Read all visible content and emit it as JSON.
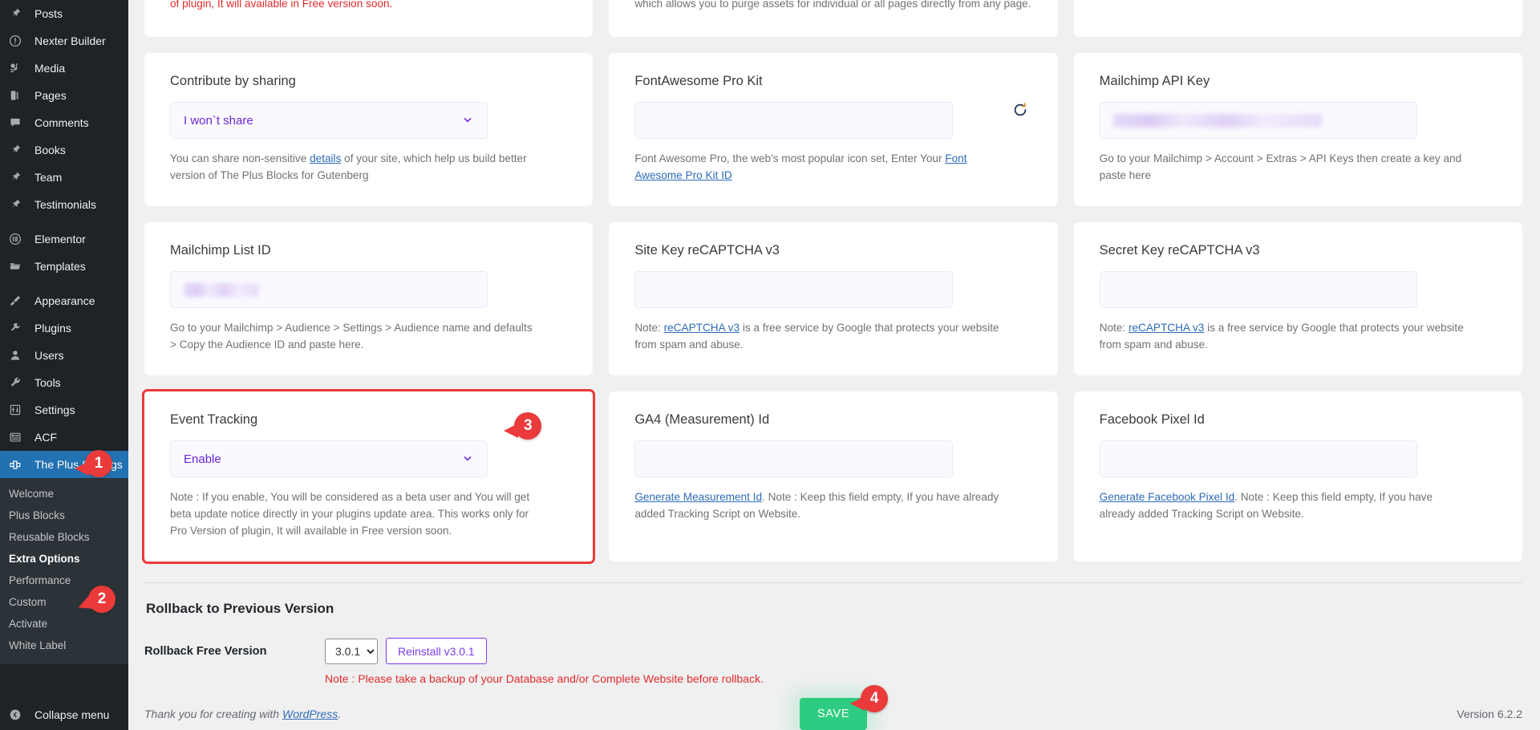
{
  "sidebar": {
    "items": [
      {
        "label": "Posts",
        "icon": "pin-icon"
      },
      {
        "label": "Nexter Builder",
        "icon": "nexter-icon"
      },
      {
        "label": "Media",
        "icon": "media-icon"
      },
      {
        "label": "Pages",
        "icon": "pages-icon"
      },
      {
        "label": "Comments",
        "icon": "comments-icon"
      },
      {
        "label": "Books",
        "icon": "pin-icon"
      },
      {
        "label": "Team",
        "icon": "pin-icon"
      },
      {
        "label": "Testimonials",
        "icon": "pin-icon"
      },
      {
        "label": "Elementor",
        "icon": "elementor-icon"
      },
      {
        "label": "Templates",
        "icon": "folder-icon"
      },
      {
        "label": "Appearance",
        "icon": "brush-icon"
      },
      {
        "label": "Plugins",
        "icon": "plug-icon"
      },
      {
        "label": "Users",
        "icon": "user-icon"
      },
      {
        "label": "Tools",
        "icon": "wrench-icon"
      },
      {
        "label": "Settings",
        "icon": "sliders-icon"
      },
      {
        "label": "ACF",
        "icon": "acf-icon"
      }
    ],
    "active_item": {
      "label": "The Plus Settings",
      "icon": "plus-settings-icon"
    },
    "submenu": [
      {
        "label": "Welcome"
      },
      {
        "label": "Plus Blocks"
      },
      {
        "label": "Reusable Blocks"
      },
      {
        "label": "Extra Options"
      },
      {
        "label": "Performance"
      },
      {
        "label": "Custom"
      },
      {
        "label": "Activate"
      },
      {
        "label": "White Label"
      }
    ],
    "current_submenu": "Extra Options",
    "collapse": {
      "label": "Collapse menu",
      "icon": "collapse-arrow-icon"
    }
  },
  "callouts": {
    "one": "1",
    "two": "2",
    "three": "3",
    "four": "4"
  },
  "cards": {
    "top_left_partial": {
      "help": "of plugin, It will available in Free version soon."
    },
    "top_mid_partial": {
      "help": "which allows you to purge assets for individual or all pages directly from any page."
    },
    "contribute": {
      "title": "Contribute by sharing",
      "value": "I won`t share",
      "help_pre": "You can share non-sensitive ",
      "help_link": "details",
      "help_post": " of your site, which help us build better version of The Plus Blocks for Gutenberg"
    },
    "fontawesome": {
      "title": "FontAwesome Pro Kit",
      "value": "",
      "help_pre": "Font Awesome Pro, the web's most popular icon set, Enter Your ",
      "help_link": "Font Awesome Pro Kit ID",
      "refresh_icon": "refresh-icon"
    },
    "mailchimp_api": {
      "title": "Mailchimp API Key",
      "value_redacted": true,
      "help": "Go to your Mailchimp > Account > Extras > API Keys then create a key and paste here"
    },
    "mailchimp_list": {
      "title": "Mailchimp List ID",
      "value_redacted": true,
      "help": "Go to your Mailchimp > Audience > Settings > Audience name and defaults > Copy the Audience ID and paste here."
    },
    "sitekey": {
      "title": "Site Key reCAPTCHA v3",
      "value": "",
      "help_pre": "Note: ",
      "help_link": "reCAPTCHA v3",
      "help_post": " is a free service by Google that protects your website from spam and abuse."
    },
    "secretkey": {
      "title": "Secret Key reCAPTCHA v3",
      "value": "",
      "help_pre": "Note: ",
      "help_link": "reCAPTCHA v3",
      "help_post": " is a free service by Google that protects your website from spam and abuse."
    },
    "event_tracking": {
      "title": "Event Tracking",
      "value": "Enable",
      "help": "Note : If you enable, You will be considered as a beta user and You will get beta update notice directly in your plugins update area. This works only for Pro Version of plugin, It will available in Free version soon."
    },
    "ga4": {
      "title": "GA4 (Measurement) Id",
      "value": "",
      "help_link": "Generate Measurement Id",
      "help_post": ". Note : Keep this field empty, If you have already added Tracking Script on Website."
    },
    "facebook_pixel": {
      "title": "Facebook Pixel Id",
      "value": "",
      "help_link": "Generate Facebook Pixel Id",
      "help_post": ". Note : Keep this field empty, If you have already added Tracking Script on Website."
    }
  },
  "rollback": {
    "heading": "Rollback to Previous Version",
    "label": "Rollback Free Version",
    "selected_version": "3.0.1",
    "version_options": [
      "3.0.1"
    ],
    "reinstall_label": "Reinstall v3.0.1",
    "note": "Note : Please take a backup of your Database and/or Complete Website before rollback."
  },
  "save": {
    "label": "SAVE"
  },
  "footer": {
    "thanks_pre": "Thank you for creating with ",
    "thanks_link": "WordPress",
    "thanks_post": ".",
    "version": "Version 6.2.2"
  }
}
